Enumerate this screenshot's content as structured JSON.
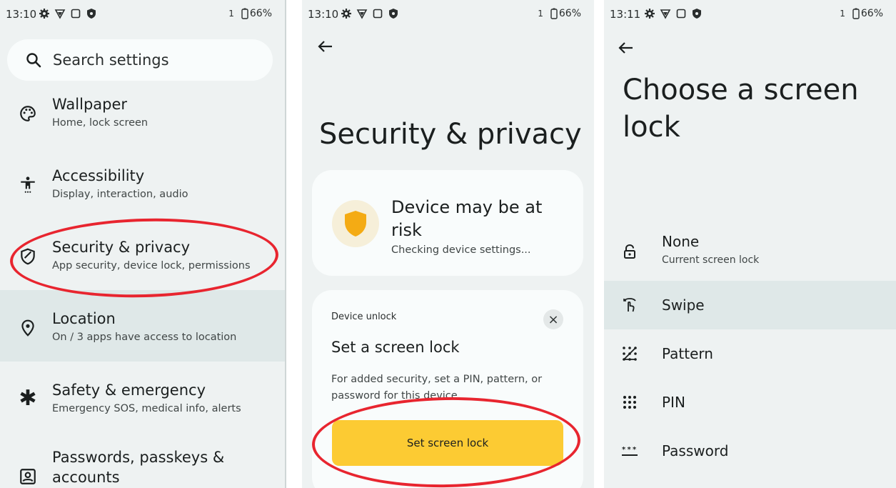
{
  "screen1": {
    "status": {
      "time": "13:10",
      "sim": "1",
      "battery": "66%"
    },
    "search_placeholder": "Search settings",
    "items": [
      {
        "title": "Wallpaper",
        "subtitle": "Home, lock screen",
        "icon": "palette-icon"
      },
      {
        "title": "Accessibility",
        "subtitle": "Display, interaction, audio",
        "icon": "accessibility-icon"
      },
      {
        "title": "Security & privacy",
        "subtitle": "App security, device lock, permissions",
        "icon": "shield-icon"
      },
      {
        "title": "Location",
        "subtitle": "On / 3 apps have access to location",
        "icon": "location-pin-icon"
      },
      {
        "title": "Safety & emergency",
        "subtitle": "Emergency SOS, medical info, alerts",
        "icon": "asterisk-icon"
      },
      {
        "title": "Passwords, passkeys &",
        "title2": "accounts",
        "icon": "account-box-icon"
      }
    ]
  },
  "screen2": {
    "status": {
      "time": "13:10",
      "sim": "1",
      "battery": "66%"
    },
    "title": "Security & privacy",
    "risk_card": {
      "title_line1": "Device may be at",
      "title_line2": "risk",
      "subtitle": "Checking device settings..."
    },
    "unlock_card": {
      "label": "Device unlock",
      "title": "Set a screen lock",
      "body_line1": "For added security, set a PIN, pattern, or",
      "body_line2": "password for this device.",
      "button": "Set screen lock",
      "close": "×"
    }
  },
  "screen3": {
    "status": {
      "time": "13:11",
      "sim": "1",
      "battery": "66%"
    },
    "title_line1": "Choose a screen",
    "title_line2": "lock",
    "options": [
      {
        "title": "None",
        "subtitle": "Current screen lock",
        "icon": "lock-icon"
      },
      {
        "title": "Swipe",
        "icon": "swipe-icon"
      },
      {
        "title": "Pattern",
        "icon": "pattern-icon"
      },
      {
        "title": "PIN",
        "icon": "pin-dots-icon"
      },
      {
        "title": "Password",
        "icon": "password-icon"
      }
    ]
  },
  "colors": {
    "background": "#eef2f2",
    "card": "#f9fcfc",
    "selected": "#dfe8e8",
    "accent_yellow": "#fccb33",
    "annotation_red": "#e8252f"
  }
}
